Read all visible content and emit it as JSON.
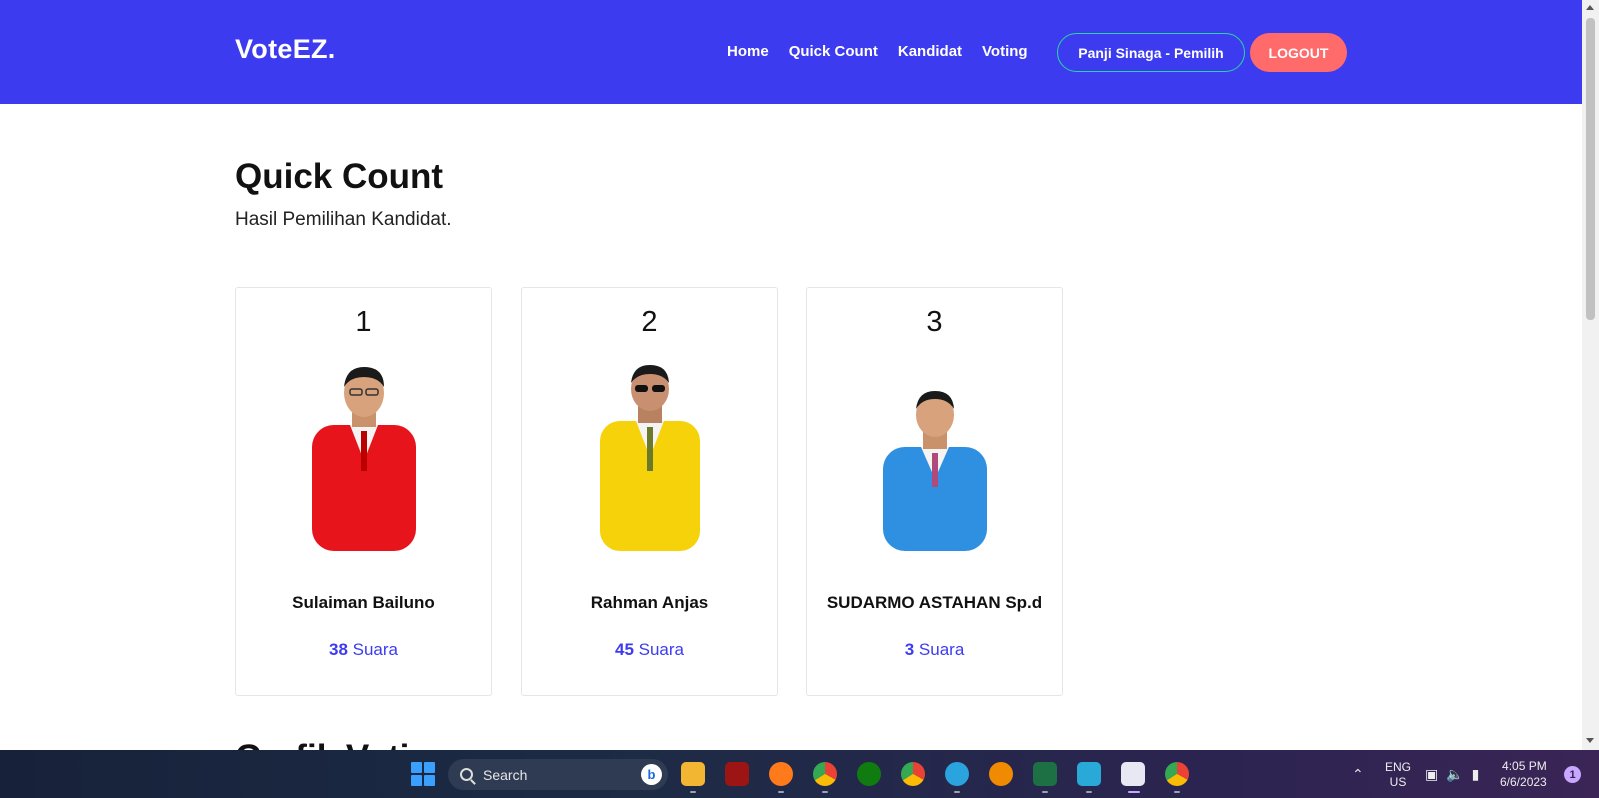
{
  "navbar": {
    "brand": "VoteEZ.",
    "links": [
      "Home",
      "Quick Count",
      "Kandidat",
      "Voting"
    ],
    "user_label": "Panji Sinaga - Pemilih",
    "logout_label": "LOGOUT",
    "colors": {
      "background": "#3d3bf0",
      "logout": "#ff6b6b",
      "user_border": "#27d6a0"
    }
  },
  "page": {
    "title": "Quick Count",
    "subtitle": "Hasil Pemilihan Kandidat.",
    "next_section_title": "Grafik Voting"
  },
  "candidates": [
    {
      "number": "1",
      "name": "Sulaiman Bailuno",
      "votes": "38",
      "votes_unit": "Suara",
      "suit_color": "#e8141c"
    },
    {
      "number": "2",
      "name": "Rahman Anjas",
      "votes": "45",
      "votes_unit": "Suara",
      "suit_color": "#f5d20a"
    },
    {
      "number": "3",
      "name": "SUDARMO ASTAHAN Sp.d",
      "votes": "3",
      "votes_unit": "Suara",
      "suit_color": "#2f8fe0"
    }
  ],
  "taskbar": {
    "search_placeholder": "Search",
    "language": {
      "line1": "ENG",
      "line2": "US"
    },
    "time": "4:05 PM",
    "date": "6/6/2023",
    "notification_count": "1",
    "apps": [
      "file-explorer-icon",
      "app-red-icon",
      "firefox-icon",
      "chrome-icon",
      "xbox-icon",
      "chrome-icon",
      "telegram-icon",
      "search-app-icon",
      "excel-icon",
      "remote-icon",
      "snipping-tool-icon",
      "chrome-icon"
    ]
  }
}
